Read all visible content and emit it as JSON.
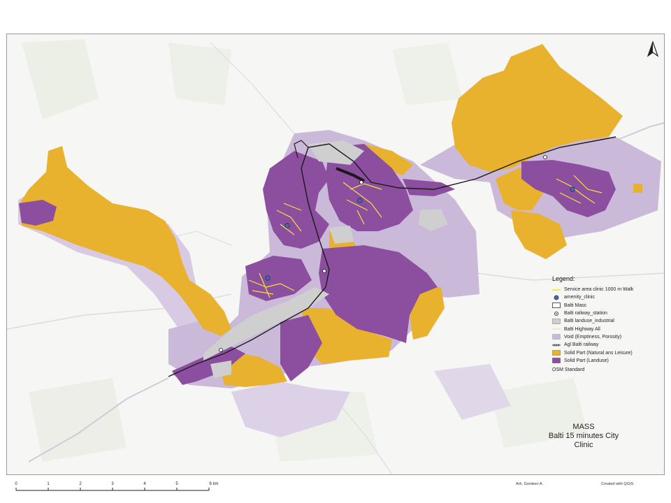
{
  "map": {
    "colors": {
      "background": "#f6f6f5",
      "void": "#cbb9d9",
      "solid_natural": "#e8b12e",
      "solid_landuse": "#8c4e9e",
      "industrial": "#cfcfcf",
      "service_area": "#f2e63a",
      "railway": "#1a1a1a",
      "clinic": "#4a67a8"
    }
  },
  "north_arrow": {
    "icon": "north-arrow-icon"
  },
  "legend": {
    "title": "Legend:",
    "items": [
      {
        "label": "Service area clinic 1000 m Walk",
        "symbol": "yellow-line"
      },
      {
        "label": "amenity_clinic",
        "symbol": "blue-circle"
      },
      {
        "label": "Balti Masc",
        "symbol": "white-box"
      },
      {
        "label": "Balti railway_station",
        "symbol": "station-dot"
      },
      {
        "label": "Balti landuse_industrial",
        "symbol": "grey-box"
      },
      {
        "label": "Balti Highway All",
        "symbol": "thin-line"
      },
      {
        "label": "Void (Emptiness, Porosity)",
        "symbol": "lavender-box"
      },
      {
        "label": "Agl Balti railway",
        "symbol": "rail-line"
      },
      {
        "label": "Solid Part (Natural ans Leisure)",
        "symbol": "gold-box"
      },
      {
        "label": "Solid Part (Landuse)",
        "symbol": "purple-box"
      }
    ],
    "basemap": "OSM Standard"
  },
  "title_block": {
    "line1": "MASS",
    "line2": "Balti 15 minutes City",
    "line3": "Clinic"
  },
  "scale": {
    "labels": [
      "0",
      "1",
      "2",
      "3",
      "4",
      "5",
      "6 km"
    ]
  },
  "credits": {
    "author": "Arh. Gordeev A.",
    "software": "Created with QGIS"
  }
}
